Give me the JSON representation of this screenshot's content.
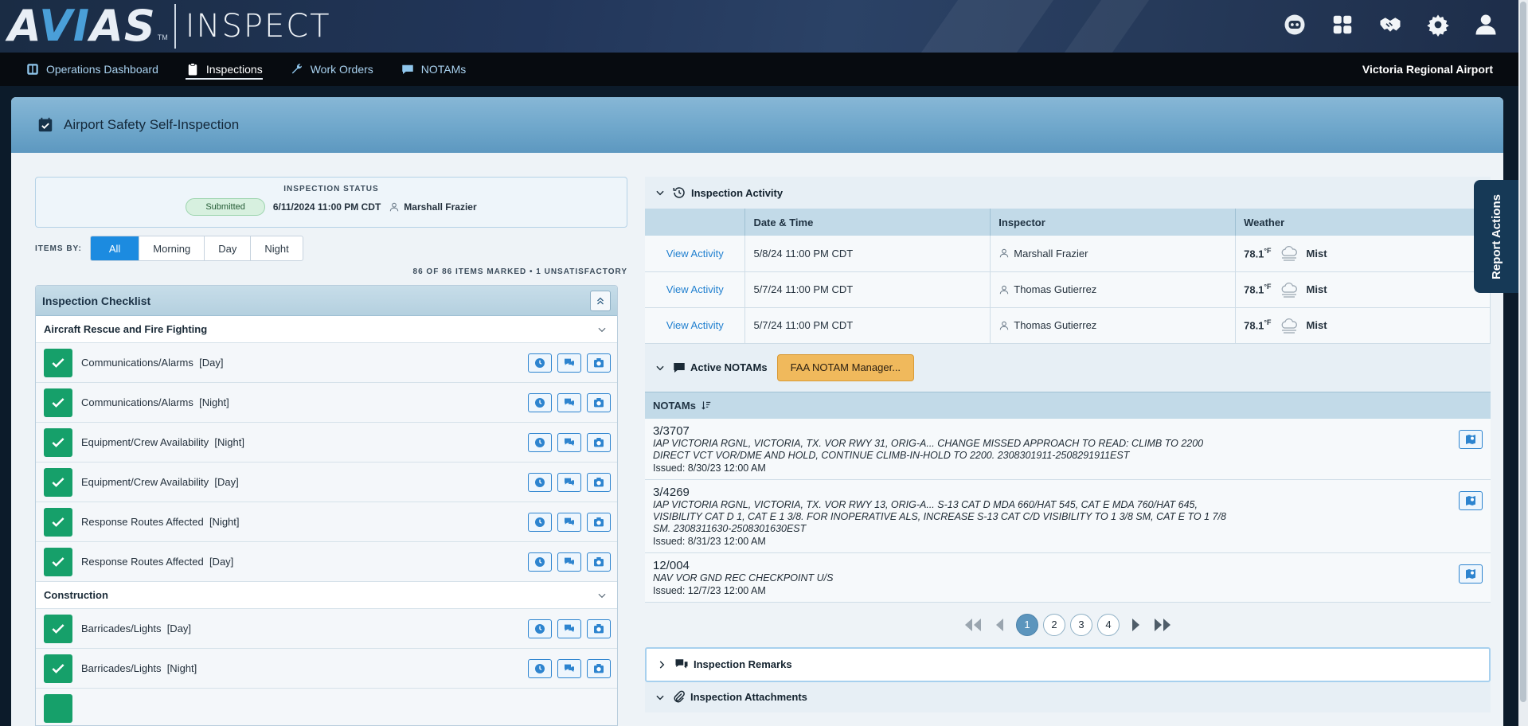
{
  "header": {
    "logo_main": "AVIAS",
    "logo_tm": "TM",
    "logo_product": "INSPECT",
    "icons": [
      "robot-assistant-icon",
      "apps-grid-icon",
      "handshake-icon",
      "gear-icon",
      "user-icon"
    ]
  },
  "nav": {
    "items": [
      {
        "label": "Operations Dashboard",
        "icon": "dashboard-icon"
      },
      {
        "label": "Inspections",
        "icon": "clipboard-icon",
        "active": true
      },
      {
        "label": "Work Orders",
        "icon": "wrench-icon"
      },
      {
        "label": "NOTAMs",
        "icon": "chat-bubble-icon"
      }
    ],
    "airport": "Victoria Regional Airport"
  },
  "page": {
    "title": "Airport Safety Self-Inspection"
  },
  "status": {
    "label": "INSPECTION STATUS",
    "badge": "Submitted",
    "datetime": "6/11/2024 11:00 PM CDT",
    "inspector": "Marshall Frazier"
  },
  "filter": {
    "label": "ITEMS BY:",
    "options": [
      "All",
      "Morning",
      "Day",
      "Night"
    ],
    "selected": "All"
  },
  "summary": "86 OF 86 ITEMS MARKED • 1 UNSATISFACTORY",
  "checklist": {
    "title": "Inspection Checklist",
    "groups": [
      {
        "name": "Aircraft Rescue and Fire Fighting",
        "items": [
          {
            "label": "Communications/Alarms",
            "period": "[Day]"
          },
          {
            "label": "Communications/Alarms",
            "period": "[Night]"
          },
          {
            "label": "Equipment/Crew Availability",
            "period": "[Night]"
          },
          {
            "label": "Equipment/Crew Availability",
            "period": "[Day]"
          },
          {
            "label": "Response Routes Affected",
            "period": "[Night]"
          },
          {
            "label": "Response Routes Affected",
            "period": "[Day]"
          }
        ]
      },
      {
        "name": "Construction",
        "items": [
          {
            "label": "Barricades/Lights",
            "period": "[Day]"
          },
          {
            "label": "Barricades/Lights",
            "period": "[Night]"
          }
        ]
      }
    ]
  },
  "activity": {
    "title": "Inspection Activity",
    "columns": [
      "",
      "Date & Time",
      "Inspector",
      "Weather"
    ],
    "rows": [
      {
        "action": "View Activity",
        "datetime": "5/8/24 11:00 PM CDT",
        "inspector": "Marshall Frazier",
        "temp": "78.1",
        "unit": "°F",
        "condition": "Mist"
      },
      {
        "action": "View Activity",
        "datetime": "5/7/24 11:00 PM CDT",
        "inspector": "Thomas Gutierrez",
        "temp": "78.1",
        "unit": "°F",
        "condition": "Mist"
      },
      {
        "action": "View Activity",
        "datetime": "5/7/24 11:00 PM CDT",
        "inspector": "Thomas Gutierrez",
        "temp": "78.1",
        "unit": "°F",
        "condition": "Mist"
      }
    ]
  },
  "notams": {
    "title": "Active NOTAMs",
    "manager_button": "FAA NOTAM Manager...",
    "column": "NOTAMs",
    "items": [
      {
        "id": "3/3707",
        "text": "IAP VICTORIA RGNL, VICTORIA, TX. VOR RWY 31, ORIG-A... CHANGE MISSED APPROACH TO READ: CLIMB TO 2200 DIRECT VCT VOR/DME AND HOLD, CONTINUE CLIMB-IN-HOLD TO 2200. 2308301911-2508291911EST",
        "issued": "Issued: 8/30/23 12:00 AM"
      },
      {
        "id": "3/4269",
        "text": "IAP VICTORIA RGNL, VICTORIA, TX. VOR RWY 13, ORIG-A... S-13 CAT D MDA 660/HAT 545, CAT E MDA 760/HAT 645, VISIBILITY CAT D 1, CAT E 1 3/8. FOR INOPERATIVE ALS, INCREASE S-13 CAT C/D VISIBILITY TO 1 3/8 SM, CAT E TO 1 7/8 SM. 2308311630-2508301630EST",
        "issued": "Issued: 8/31/23 12:00 AM"
      },
      {
        "id": "12/004",
        "text": "NAV VOR GND REC CHECKPOINT U/S",
        "issued": "Issued: 12/7/23 12:00 AM"
      }
    ],
    "pages": [
      "1",
      "2",
      "3",
      "4"
    ],
    "current_page": "1"
  },
  "remarks": {
    "title": "Inspection Remarks"
  },
  "attachments": {
    "title": "Inspection Attachments"
  },
  "report_actions": "Report Actions",
  "colors": {
    "accent": "#1c8be0",
    "check_green": "#16a06a",
    "faa_button": "#f0b95c",
    "nav_bg": "#070b10"
  }
}
